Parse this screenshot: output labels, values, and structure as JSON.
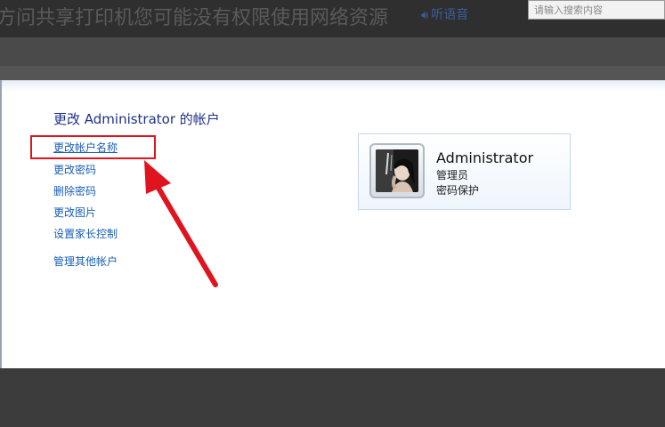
{
  "header": {
    "title": "方问共享打印机您可能没有权限使用网络资源",
    "listen_label": "听语音",
    "search_placeholder": "请输入搜索内容"
  },
  "panel": {
    "title": "更改 Administrator 的帐户",
    "tasks": [
      "更改帐户名称",
      "更改密码",
      "删除密码",
      "更改图片",
      "设置家长控制",
      "管理其他帐户"
    ]
  },
  "user": {
    "name": "Administrator",
    "role": "管理员",
    "password_status": "密码保护"
  },
  "colors": {
    "accent_link": "#1a5fb4",
    "title": "#1e3287",
    "annotation_red": "#e0141e"
  }
}
